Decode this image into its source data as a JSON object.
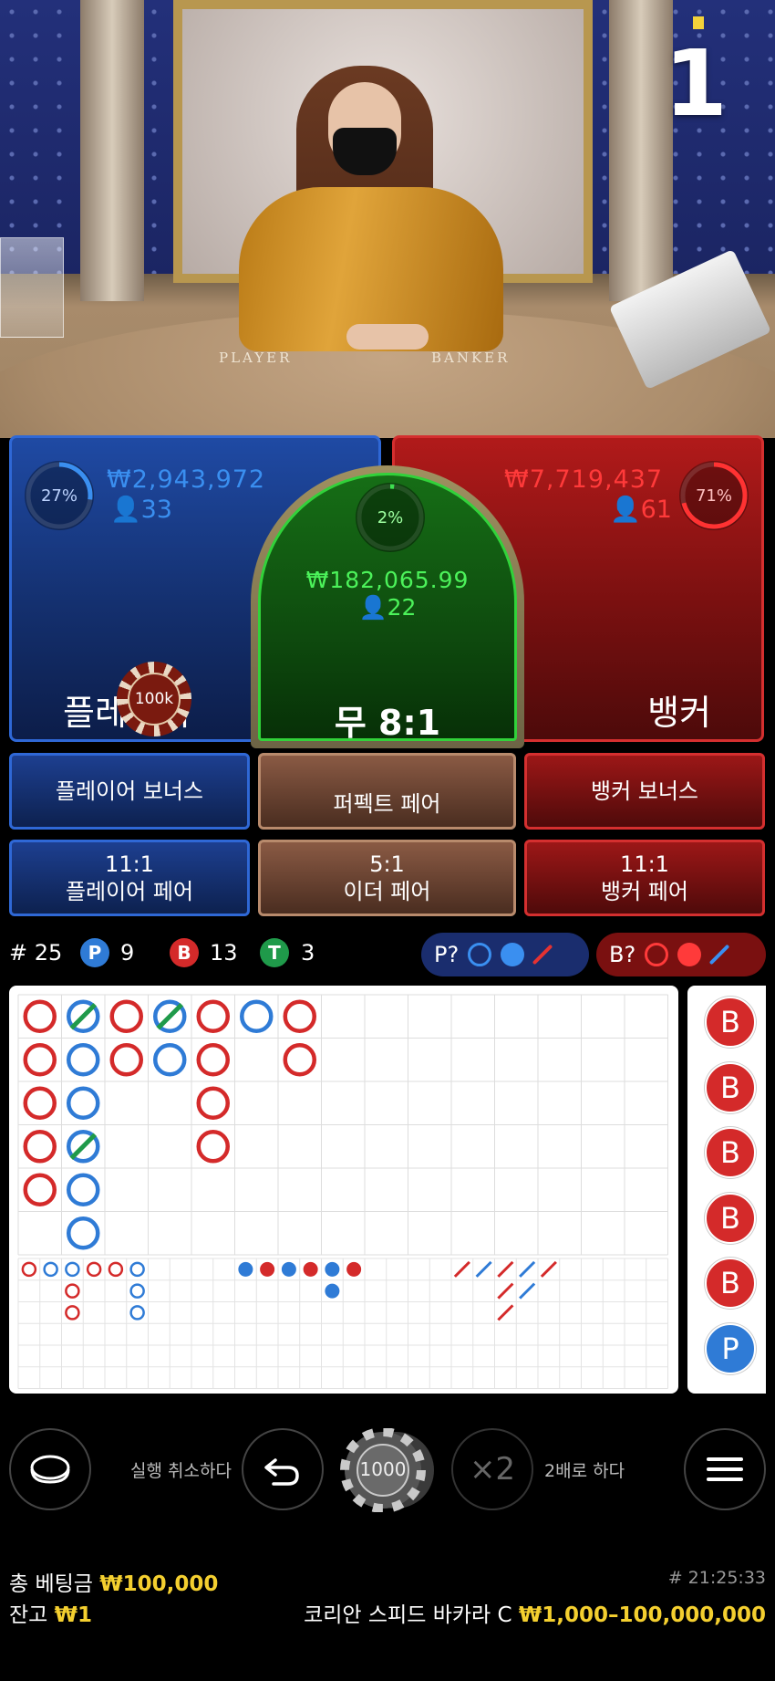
{
  "round_number": "1",
  "table_labels": {
    "player": "PLAYER",
    "banker": "BANKER"
  },
  "player": {
    "percent": "27%",
    "amount": "₩2,943,972",
    "bettors": "33",
    "label": "플레이어"
  },
  "tie": {
    "percent": "2%",
    "amount": "₩182,065.99",
    "bettors": "22",
    "label": "무 8:1"
  },
  "banker": {
    "percent": "71%",
    "amount": "₩7,719,437",
    "bettors": "61",
    "label": "뱅커"
  },
  "placed_chip": "100k",
  "side_bets": {
    "player_bonus": "플레이어 보너스",
    "perfect_pair": "퍼펙트 페어",
    "banker_bonus": "뱅커 보너스",
    "player_pair_odds": "11:1",
    "player_pair": "플레이어 페어",
    "either_pair_odds": "5:1",
    "either_pair": "이더 페어",
    "banker_pair_odds": "11:1",
    "banker_pair": "뱅커 페어"
  },
  "stats": {
    "round_label": "# 25",
    "p_badge": "P",
    "p_count": "9",
    "b_badge": "B",
    "b_count": "13",
    "t_badge": "T",
    "t_count": "3"
  },
  "predict": {
    "player": "P?",
    "banker": "B?"
  },
  "colors": {
    "player": "#2f7bd6",
    "banker": "#d42a2a",
    "tie": "#1f9a4a",
    "gold": "#f4cf2f"
  },
  "big_road": [
    {
      "col": 0,
      "row": 0,
      "c": "B"
    },
    {
      "col": 0,
      "row": 1,
      "c": "B"
    },
    {
      "col": 0,
      "row": 2,
      "c": "B"
    },
    {
      "col": 0,
      "row": 3,
      "c": "B"
    },
    {
      "col": 0,
      "row": 4,
      "c": "B"
    },
    {
      "col": 1,
      "row": 0,
      "c": "P",
      "tie": true
    },
    {
      "col": 1,
      "row": 1,
      "c": "P"
    },
    {
      "col": 1,
      "row": 2,
      "c": "P"
    },
    {
      "col": 1,
      "row": 3,
      "c": "P",
      "tie": true
    },
    {
      "col": 1,
      "row": 4,
      "c": "P"
    },
    {
      "col": 1,
      "row": 5,
      "c": "P"
    },
    {
      "col": 2,
      "row": 0,
      "c": "B"
    },
    {
      "col": 2,
      "row": 1,
      "c": "B"
    },
    {
      "col": 3,
      "row": 0,
      "c": "P",
      "tie": true
    },
    {
      "col": 3,
      "row": 1,
      "c": "P"
    },
    {
      "col": 4,
      "row": 0,
      "c": "B"
    },
    {
      "col": 4,
      "row": 1,
      "c": "B"
    },
    {
      "col": 4,
      "row": 2,
      "c": "B"
    },
    {
      "col": 4,
      "row": 3,
      "c": "B"
    },
    {
      "col": 5,
      "row": 0,
      "c": "P"
    },
    {
      "col": 6,
      "row": 0,
      "c": "B"
    },
    {
      "col": 6,
      "row": 1,
      "c": "B"
    }
  ],
  "big_eye_road": [
    {
      "col": 0,
      "row": 0,
      "c": "B"
    },
    {
      "col": 1,
      "row": 0,
      "c": "P"
    },
    {
      "col": 2,
      "row": 0,
      "c": "P"
    },
    {
      "col": 3,
      "row": 0,
      "c": "B"
    },
    {
      "col": 4,
      "row": 0,
      "c": "B"
    },
    {
      "col": 5,
      "row": 0,
      "c": "P"
    },
    {
      "col": 2,
      "row": 1,
      "c": "B"
    },
    {
      "col": 5,
      "row": 1,
      "c": "P"
    },
    {
      "col": 2,
      "row": 2,
      "c": "B"
    },
    {
      "col": 5,
      "row": 2,
      "c": "P"
    }
  ],
  "small_road": [
    {
      "col": 0,
      "row": 0,
      "c": "P"
    },
    {
      "col": 1,
      "row": 0,
      "c": "B"
    },
    {
      "col": 2,
      "row": 0,
      "c": "P"
    },
    {
      "col": 3,
      "row": 0,
      "c": "B"
    },
    {
      "col": 4,
      "row": 0,
      "c": "P"
    },
    {
      "col": 5,
      "row": 0,
      "c": "B"
    },
    {
      "col": 4,
      "row": 1,
      "c": "P"
    }
  ],
  "cockroach_road": [
    {
      "col": 0,
      "row": 0,
      "c": "B"
    },
    {
      "col": 1,
      "row": 0,
      "c": "P"
    },
    {
      "col": 2,
      "row": 0,
      "c": "B"
    },
    {
      "col": 3,
      "row": 0,
      "c": "P"
    },
    {
      "col": 4,
      "row": 0,
      "c": "B"
    },
    {
      "col": 2,
      "row": 1,
      "c": "B"
    },
    {
      "col": 3,
      "row": 1,
      "c": "P"
    },
    {
      "col": 2,
      "row": 2,
      "c": "B"
    }
  ],
  "bead_road": [
    "B",
    "B",
    "B",
    "B",
    "B",
    "P"
  ],
  "controls": {
    "undo_label": "실행 취소하다",
    "chip_value": "1000",
    "double_symbol": "×2",
    "double_label": "2배로 하다"
  },
  "footer": {
    "total_bet_label": "총 베팅금",
    "total_bet": "₩100,000",
    "balance_label": "잔고",
    "balance": "₩1",
    "time": "# 21:25:33",
    "table_name": "코리안 스피드 바카라 C",
    "limits": "₩1,000–100,000,000"
  }
}
